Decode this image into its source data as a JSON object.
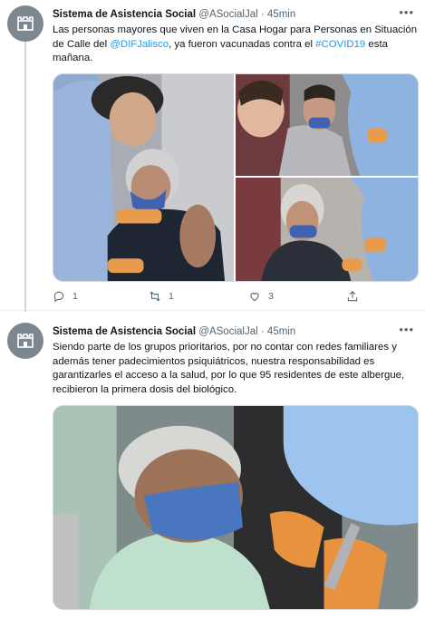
{
  "tweets": [
    {
      "author_name": "Sistema de Asistencia Social",
      "handle": "@ASocialJal",
      "separator": "·",
      "time": "45min",
      "text_parts": [
        "Las personas mayores que viven en la Casa Hogar para Personas en Situación de Calle del ",
        "@DIFJalisco",
        ", ya fueron vacunadas contra el ",
        "#COVID19",
        " esta mañana."
      ],
      "replies": "1",
      "retweets": "1",
      "likes": "3",
      "media_count": 3
    },
    {
      "author_name": "Sistema de Asistencia Social",
      "handle": "@ASocialJal",
      "separator": "·",
      "time": "45min",
      "text": "Siendo parte de los grupos prioritarios, por no contar con redes familiares y además tener padecimientos psiquiátricos, nuestra responsabilidad es garantizarles el acceso a la salud, por lo que 95 residentes de este albergue, recibieron la primera dosis del biológico.",
      "media_count": 1
    }
  ],
  "icons": {
    "avatar": "building-logo-icon",
    "more": "more-options-icon",
    "reply": "reply-icon",
    "retweet": "retweet-icon",
    "like": "heart-icon",
    "share": "share-icon"
  },
  "colors": {
    "link": "#1d9bf0",
    "secondary_text": "#536471",
    "avatar_bg": "#7d8790"
  }
}
